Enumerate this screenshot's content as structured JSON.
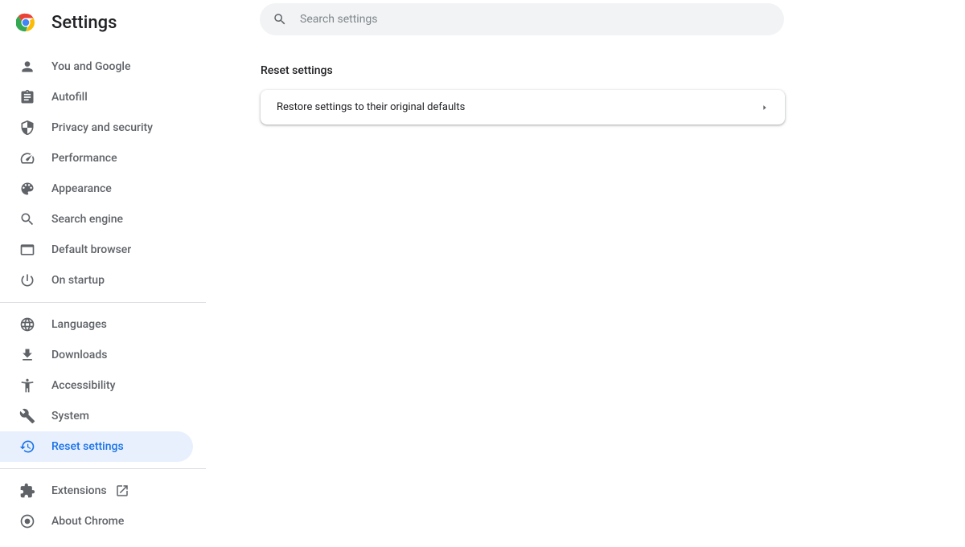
{
  "header": {
    "title": "Settings"
  },
  "search": {
    "placeholder": "Search settings"
  },
  "sidebar": {
    "group1": [
      {
        "label": "You and Google"
      },
      {
        "label": "Autofill"
      },
      {
        "label": "Privacy and security"
      },
      {
        "label": "Performance"
      },
      {
        "label": "Appearance"
      },
      {
        "label": "Search engine"
      },
      {
        "label": "Default browser"
      },
      {
        "label": "On startup"
      }
    ],
    "group2": [
      {
        "label": "Languages"
      },
      {
        "label": "Downloads"
      },
      {
        "label": "Accessibility"
      },
      {
        "label": "System"
      },
      {
        "label": "Reset settings"
      }
    ],
    "group3": [
      {
        "label": "Extensions"
      },
      {
        "label": "About Chrome"
      }
    ]
  },
  "main": {
    "section_title": "Reset settings",
    "restore_label": "Restore settings to their original defaults"
  }
}
